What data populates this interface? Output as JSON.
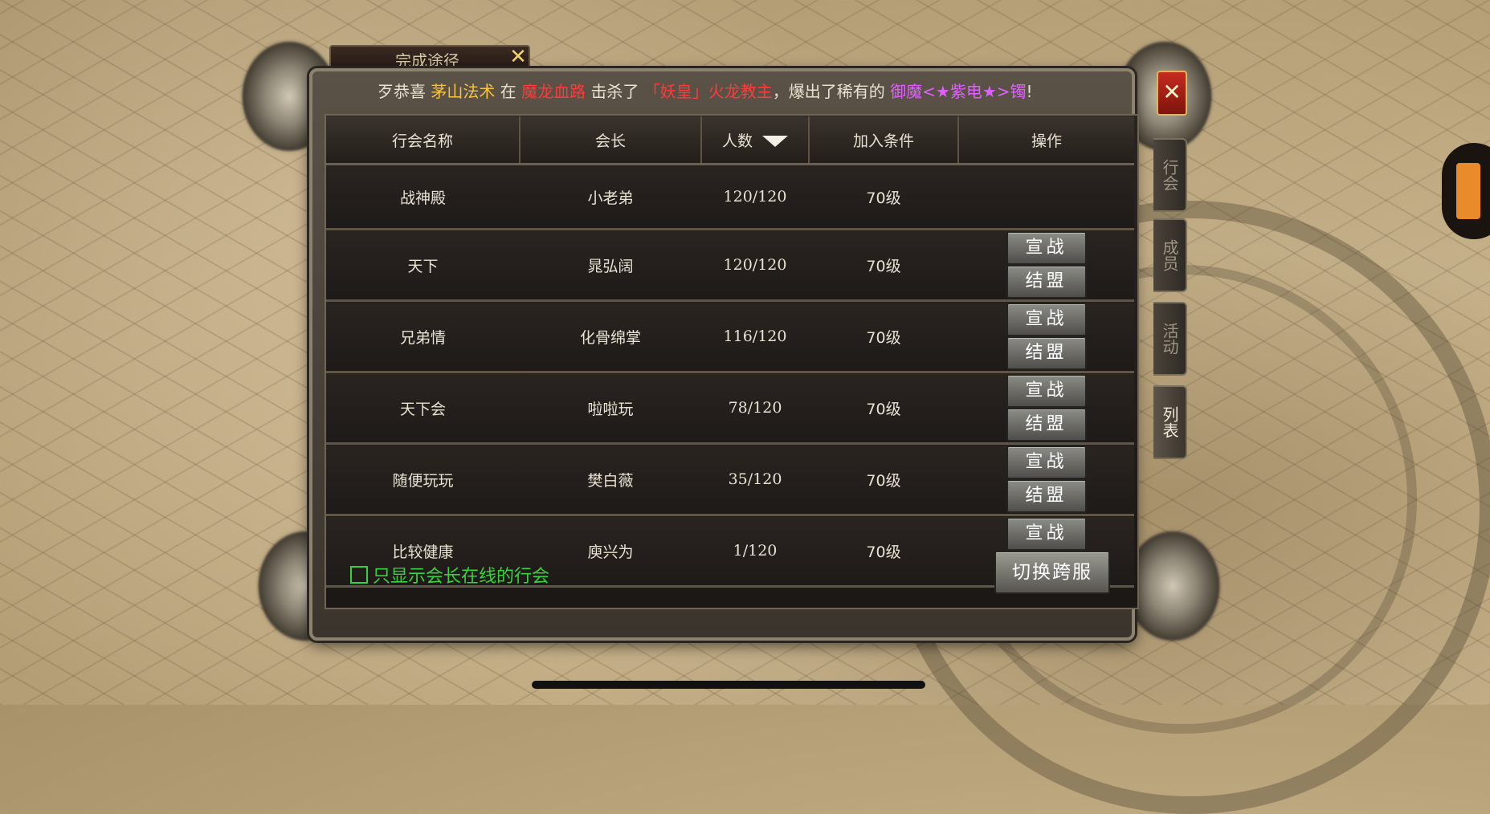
{
  "quest_tab": {
    "label": "完成途径",
    "close": "✕"
  },
  "broadcast": {
    "prefix": "歹恭喜",
    "player": "茅山法术",
    "at": "在",
    "map": "魔龙血路",
    "killed": "击杀了",
    "boss": "「妖皇」火龙教主",
    "dropped": "，爆出了稀有的",
    "item": "御魔<★紫电★>镯",
    "suffix": "!"
  },
  "panel": {
    "close_label": "✕"
  },
  "side_tabs": [
    {
      "label": "行会",
      "active": false
    },
    {
      "label": "成员",
      "active": false
    },
    {
      "label": "活动",
      "active": false
    },
    {
      "label": "列表",
      "active": true
    }
  ],
  "table": {
    "headers": [
      "行会名称",
      "会长",
      "人数",
      "加入条件",
      "操作"
    ],
    "rows": [
      {
        "name": "战神殿",
        "leader": "小老弟",
        "members": "120/120",
        "requirement": "70级",
        "actions": false
      },
      {
        "name": "天下",
        "leader": "晁弘阔",
        "members": "120/120",
        "requirement": "70级",
        "actions": true
      },
      {
        "name": "兄弟情",
        "leader": "化骨绵掌",
        "members": "116/120",
        "requirement": "70级",
        "actions": true
      },
      {
        "name": "天下会",
        "leader": "啦啦玩",
        "members": "78/120",
        "requirement": "70级",
        "actions": true
      },
      {
        "name": "随便玩玩",
        "leader": "樊白薇",
        "members": "35/120",
        "requirement": "70级",
        "actions": true
      },
      {
        "name": "比较健康",
        "leader": "庾兴为",
        "members": "1/120",
        "requirement": "70级",
        "actions": true
      }
    ],
    "war_label": "宣战",
    "ally_label": "结盟"
  },
  "footer": {
    "checkbox_label": "只显示会长在线的行会",
    "switch_label": "切换跨服"
  },
  "colors": {
    "highlight_yellow": "#f5c542",
    "highlight_red": "#ff3a3a",
    "highlight_purple": "#e060ff",
    "checkbox_green": "#35d43c"
  }
}
